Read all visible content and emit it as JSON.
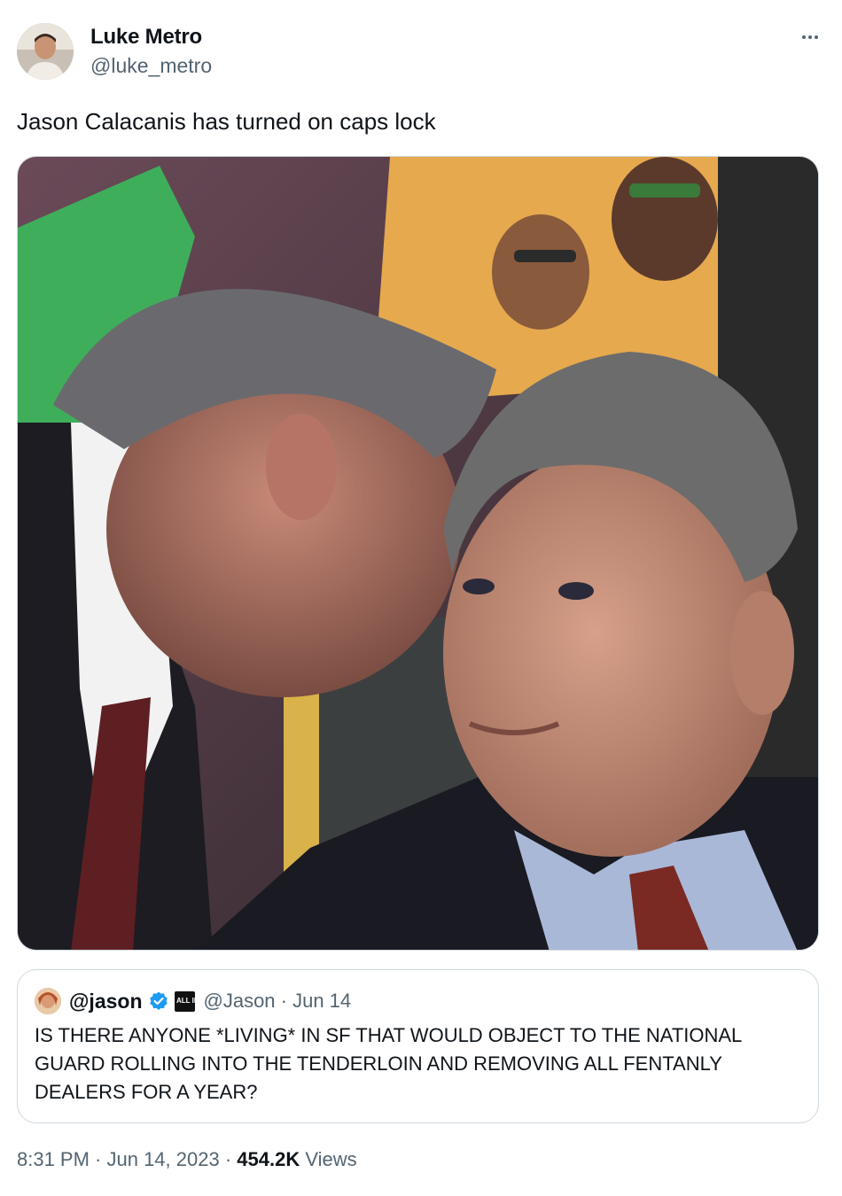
{
  "author": {
    "name": "Luke Metro",
    "handle": "@luke_metro",
    "avatar_icon": "user-avatar"
  },
  "more_icon": "more-horizontal-icon",
  "tweet": {
    "text": "Jason Calacanis has turned on caps lock",
    "media_description": "photo"
  },
  "quoted_tweet": {
    "name": "@jason",
    "verified_icon": "verified-badge-icon",
    "affiliate_badge": "ALL IN",
    "meta": "@Jason · Jun 14",
    "text": "IS THERE ANYONE *LIVING* IN SF THAT WOULD OBJECT TO THE NATIONAL GUARD ROLLING INTO THE TENDERLOIN AND REMOVING ALL FENTANLY DEALERS FOR A YEAR?"
  },
  "footer": {
    "timestamp": "8:31 PM · Jun 14, 2023 · ",
    "views_count": "454.2K",
    "views_label": " Views"
  },
  "colors": {
    "text_primary": "#0f1419",
    "text_secondary": "#536471",
    "border": "#cfd9de",
    "verified_blue": "#1d9bf0"
  }
}
